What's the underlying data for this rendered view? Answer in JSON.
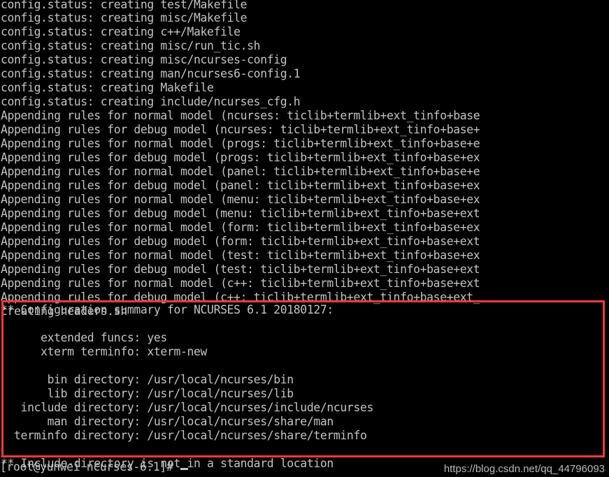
{
  "terminal": {
    "background_color": "#000000",
    "text_color": "#c3c3c3",
    "highlight_border_color": "#f9393c",
    "scrollback": [
      "config.status: creating test/Makefile",
      "config.status: creating misc/Makefile",
      "config.status: creating c++/Makefile",
      "config.status: creating misc/run_tic.sh",
      "config.status: creating misc/ncurses-config",
      "config.status: creating man/ncurses6-config.1",
      "config.status: creating Makefile",
      "config.status: creating include/ncurses_cfg.h",
      "Appending rules for normal model (ncurses: ticlib+termlib+ext_tinfo+base",
      "Appending rules for debug model (ncurses: ticlib+termlib+ext_tinfo+base+",
      "Appending rules for normal model (progs: ticlib+termlib+ext_tinfo+base+e",
      "Appending rules for debug model (progs: ticlib+termlib+ext_tinfo+base+ex",
      "Appending rules for normal model (panel: ticlib+termlib+ext_tinfo+base+e",
      "Appending rules for debug model (panel: ticlib+termlib+ext_tinfo+base+ex",
      "Appending rules for normal model (menu: ticlib+termlib+ext_tinfo+base+ex",
      "Appending rules for debug model (menu: ticlib+termlib+ext_tinfo+base+ext",
      "Appending rules for normal model (form: ticlib+termlib+ext_tinfo+base+ex",
      "Appending rules for debug model (form: ticlib+termlib+ext_tinfo+base+ext",
      "Appending rules for normal model (test: ticlib+termlib+ext_tinfo+base+ex",
      "Appending rules for debug model (test: ticlib+termlib+ext_tinfo+base+ext",
      "Appending rules for normal model (c++: ticlib+termlib+ext_tinfo+base+ext",
      "Appending rules for debug model (c++: ticlib+termlib+ext_tinfo+base+ext_",
      "creating headers.sh",
      ""
    ],
    "summary": {
      "header": "** Configuration summary for NCURSES 6.1 20180127:",
      "blank_1": "",
      "options": [
        "      extended funcs: yes",
        "      xterm terminfo: xterm-new"
      ],
      "blank_2": "",
      "directories": [
        "       bin directory: /usr/local/ncurses/bin",
        "       lib directory: /usr/local/ncurses/lib",
        "   include directory: /usr/local/ncurses/include/ncurses",
        "       man directory: /usr/local/ncurses/share/man",
        "  terminfo directory: /usr/local/ncurses/share/terminfo"
      ],
      "blank_3": "",
      "warning": "** Include-directory is not in a standard location"
    },
    "prompt": {
      "text": "[root@yunwei ncurses-6.1]# ",
      "cursor": "_"
    }
  },
  "watermark": {
    "text": "https://blog.csdn.net/qq_44796093"
  }
}
